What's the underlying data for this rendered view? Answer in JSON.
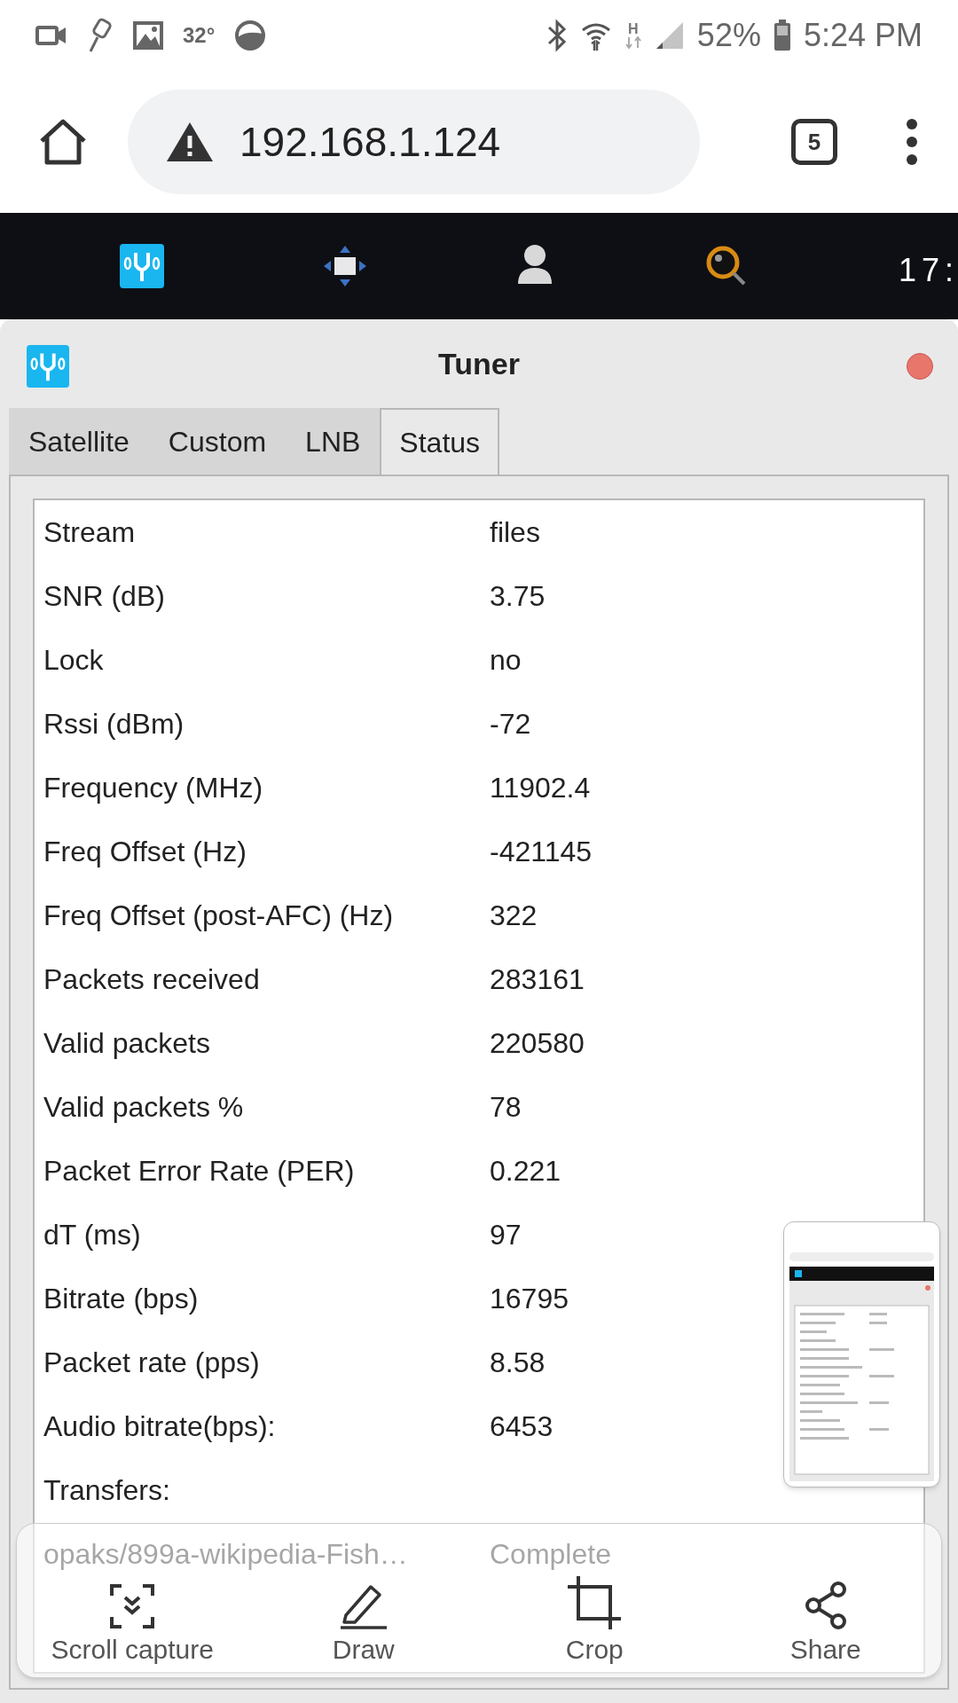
{
  "status_bar": {
    "temperature": "32°",
    "network_type": "H",
    "battery": "52%",
    "time": "5:24 PM"
  },
  "browser": {
    "url": "192.168.1.124",
    "tab_count": "5"
  },
  "desktop_bar": {
    "clock": "17:"
  },
  "window": {
    "title": "Tuner"
  },
  "tabs": [
    {
      "label": "Satellite",
      "selected": false
    },
    {
      "label": "Custom",
      "selected": false
    },
    {
      "label": "LNB",
      "selected": false
    },
    {
      "label": "Status",
      "selected": true
    }
  ],
  "status_rows": [
    {
      "label": "Stream",
      "value": "files"
    },
    {
      "label": "SNR (dB)",
      "value": "3.75"
    },
    {
      "label": "Lock",
      "value": "no"
    },
    {
      "label": "Rssi (dBm)",
      "value": "-72"
    },
    {
      "label": "Frequency (MHz)",
      "value": "11902.4"
    },
    {
      "label": "Freq Offset (Hz)",
      "value": "-421145"
    },
    {
      "label": "Freq Offset (post-AFC) (Hz)",
      "value": "322"
    },
    {
      "label": "Packets received",
      "value": "283161"
    },
    {
      "label": "Valid packets",
      "value": "220580"
    },
    {
      "label": "Valid packets %",
      "value": "78"
    },
    {
      "label": "Packet Error Rate (PER)",
      "value": "0.221"
    },
    {
      "label": "dT (ms)",
      "value": "97"
    },
    {
      "label": "Bitrate (bps)",
      "value": "16795"
    },
    {
      "label": "Packet rate (pps)",
      "value": "8.58"
    },
    {
      "label": "Audio bitrate(bps):",
      "value": "6453"
    }
  ],
  "transfers_heading": "Transfers:",
  "transfers": [
    {
      "file": "opaks/899a-wikipedia-Fish…",
      "state": "Complete"
    }
  ],
  "capture_toolbar": [
    {
      "kind": "scroll",
      "label": "Scroll capture"
    },
    {
      "kind": "draw",
      "label": "Draw"
    },
    {
      "kind": "crop",
      "label": "Crop"
    },
    {
      "kind": "share",
      "label": "Share"
    }
  ]
}
